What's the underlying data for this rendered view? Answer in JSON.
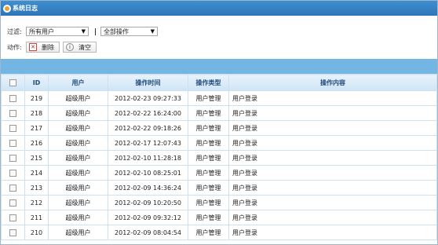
{
  "window": {
    "title": "系统日志"
  },
  "filter": {
    "label": "过滤:",
    "user_select": "所有用户",
    "operation_select": "全部操作"
  },
  "actions": {
    "label": "动作:",
    "delete_label": "删除",
    "clear_label": "清空"
  },
  "table": {
    "columns": [
      "",
      "ID",
      "用户",
      "操作时间",
      "操作类型",
      "操作内容"
    ],
    "rows": [
      {
        "id": "219",
        "user": "超级用户",
        "time": "2012-02-23 09:27:33",
        "type": "用户管理",
        "content": "用户登录"
      },
      {
        "id": "218",
        "user": "超级用户",
        "time": "2012-02-22 16:24:00",
        "type": "用户管理",
        "content": "用户登录"
      },
      {
        "id": "217",
        "user": "超级用户",
        "time": "2012-02-22 09:18:26",
        "type": "用户管理",
        "content": "用户登录"
      },
      {
        "id": "216",
        "user": "超级用户",
        "time": "2012-02-17 12:07:43",
        "type": "用户管理",
        "content": "用户登录"
      },
      {
        "id": "215",
        "user": "超级用户",
        "time": "2012-02-10 11:28:18",
        "type": "用户管理",
        "content": "用户登录"
      },
      {
        "id": "214",
        "user": "超级用户",
        "time": "2012-02-10 08:25:01",
        "type": "用户管理",
        "content": "用户登录"
      },
      {
        "id": "213",
        "user": "超级用户",
        "time": "2012-02-09 14:36:24",
        "type": "用户管理",
        "content": "用户登录"
      },
      {
        "id": "212",
        "user": "超级用户",
        "time": "2012-02-09 10:20:50",
        "type": "用户管理",
        "content": "用户登录"
      },
      {
        "id": "211",
        "user": "超级用户",
        "time": "2012-02-09 09:32:12",
        "type": "用户管理",
        "content": "用户登录"
      },
      {
        "id": "210",
        "user": "超级用户",
        "time": "2012-02-09 08:04:54",
        "type": "用户管理",
        "content": "用户登录"
      }
    ]
  },
  "icons": {
    "title": "gear-icon",
    "delete": "delete-icon",
    "clear": "info-icon"
  },
  "colors": {
    "title_bar": "#2f7bbf",
    "header_strip": "#74b6e3",
    "table_header": "#d9eaf7"
  }
}
